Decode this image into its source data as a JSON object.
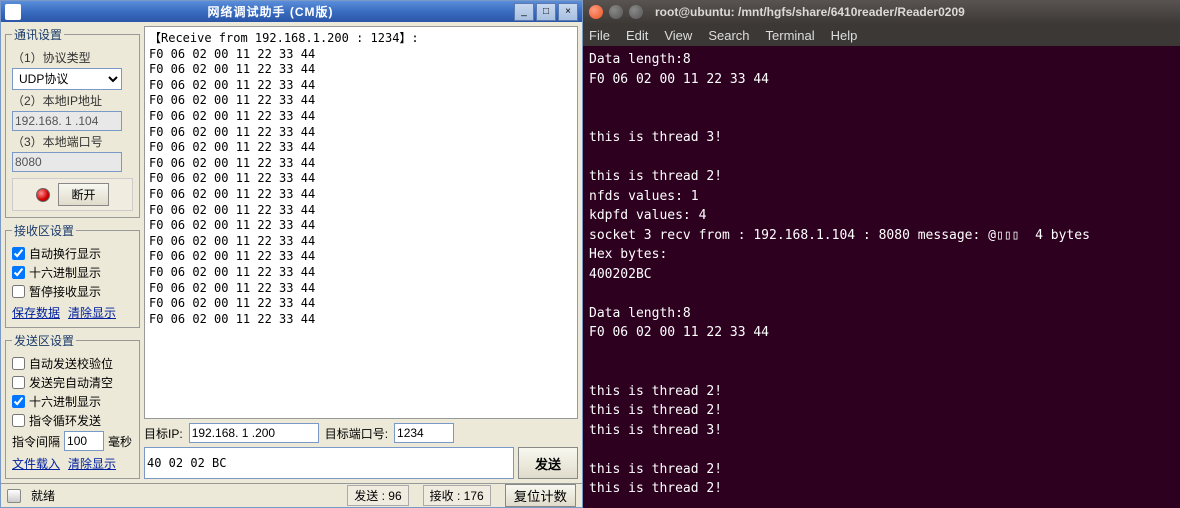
{
  "left": {
    "title": "网络调试助手 (CM版)",
    "comm_settings": {
      "legend": "通讯设置",
      "proto_label": "（1）协议类型",
      "proto_value": "UDP协议",
      "ip_label": "（2）本地IP地址",
      "ip_value": "192.168. 1 .104",
      "port_label": "（3）本地端口号",
      "port_value": "8080",
      "disconnect": "断开"
    },
    "recv_settings": {
      "legend": "接收区设置",
      "auto_wrap": "自动换行显示",
      "hex_display": "十六进制显示",
      "pause_recv": "暂停接收显示",
      "save_link": "保存数据",
      "clear_link": "清除显示"
    },
    "send_settings": {
      "legend": "发送区设置",
      "auto_check": "自动发送校验位",
      "auto_clear": "发送完自动清空",
      "hex_send": "十六进制显示",
      "loop_send": "指令循环发送",
      "interval_label": "指令间隔",
      "interval_value": "100",
      "interval_unit": "毫秒",
      "file_link": "文件载入",
      "clear_link": "清除显示"
    },
    "recv_header": "【Receive from 192.168.1.200 : 1234】:",
    "recv_line": "F0 06 02 00 11 22 33 44",
    "recv_count": 18,
    "target_ip_label": "目标IP:",
    "target_ip": "192.168. 1 .200",
    "target_port_label": "目标端口号:",
    "target_port": "1234",
    "send_value": "40 02 02 BC",
    "send_btn": "发送",
    "status": {
      "ready": "就绪",
      "sent_label": "发送 :",
      "sent_value": "96",
      "recv_label": "接收 :",
      "recv_value": "176",
      "reset_btn": "复位计数"
    }
  },
  "right": {
    "title": "root@ubuntu: /mnt/hgfs/share/6410reader/Reader0209",
    "menu": [
      "File",
      "Edit",
      "View",
      "Search",
      "Terminal",
      "Help"
    ],
    "lines": [
      "Data length:8",
      "F0 06 02 00 11 22 33 44",
      "",
      "",
      "this is thread 3!",
      "",
      "this is thread 2!",
      "nfds values: 1",
      "kdpfd values: 4",
      "socket 3 recv from : 192.168.1.104 : 8080 message: @▯▯▯  4 bytes",
      "Hex bytes:",
      "400202BC",
      "",
      "Data length:8",
      "F0 06 02 00 11 22 33 44",
      "",
      "",
      "this is thread 2!",
      "this is thread 2!",
      "this is thread 3!",
      "",
      "this is thread 2!",
      "this is thread 2!"
    ]
  }
}
